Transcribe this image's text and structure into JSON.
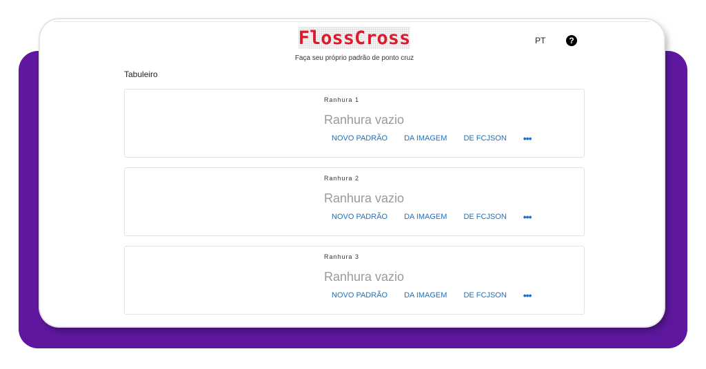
{
  "header": {
    "logo": "FlossCross",
    "tagline": "Faça seu próprio padrão de ponto cruz",
    "language": "PT",
    "help_glyph": "?",
    "icons": [
      "help-icon"
    ]
  },
  "board": {
    "title": "Tabuleiro",
    "slots": [
      {
        "label": "Ranhura 1",
        "status": "Ranhura vazio",
        "actions": [
          "NOVO PADRÃO",
          "DA IMAGEM",
          "DE FCJSON"
        ],
        "more_glyph": "•••"
      },
      {
        "label": "Ranhura 2",
        "status": "Ranhura vazio",
        "actions": [
          "NOVO PADRÃO",
          "DA IMAGEM",
          "DE FCJSON"
        ],
        "more_glyph": "•••"
      },
      {
        "label": "Ranhura 3",
        "status": "Ranhura vazio",
        "actions": [
          "NOVO PADRÃO",
          "DA IMAGEM",
          "DE FCJSON"
        ],
        "more_glyph": "•••"
      }
    ]
  },
  "colors": {
    "backdrop": "#5f17a0",
    "logo": "#e0182c",
    "action_link": "#1e6fc1",
    "muted_text": "#9a9a9a"
  }
}
